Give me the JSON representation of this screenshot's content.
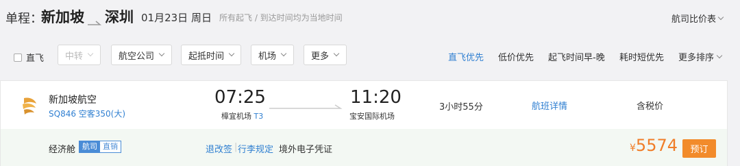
{
  "header": {
    "trip_label": "单程：",
    "from_city": "新加坡",
    "to_city": "深圳",
    "date": "01月23日 周日",
    "note": "所有起飞 / 到达时间均为当地时间",
    "compare_label": "航司比价表"
  },
  "filters": {
    "direct_label": "直飞",
    "dropdowns": [
      "中转",
      "航空公司",
      "起抵时间",
      "机场",
      "更多"
    ],
    "sorts": [
      "直飞优先",
      "低价优先",
      "起飞时间早-晚",
      "耗时短优先",
      "更多排序"
    ]
  },
  "flight": {
    "airline": "新加坡航空",
    "flight_no": "SQ846 空客350(大)",
    "dep_time": "07:25",
    "dep_airport": "樟宜机场",
    "dep_terminal": "T3",
    "arr_time": "11:20",
    "arr_airport": "宝安国际机场",
    "duration": "3小时55分",
    "details_link": "航班详情",
    "tax_label": "含税价",
    "cabin": "经济舱",
    "badge_a": "航司",
    "badge_b": "直销",
    "policy_1": "退改签",
    "policy_sep": "|",
    "policy_2": "行李规定",
    "receipt": "境外电子凭证",
    "price_symbol": "¥",
    "price": "5574",
    "book_label": "预订"
  },
  "colors": {
    "accent_blue": "#2f7fd1",
    "price_orange": "#f07d28",
    "book_button": "#f28b2b",
    "card_sub_bg": "#f3f8f3"
  }
}
